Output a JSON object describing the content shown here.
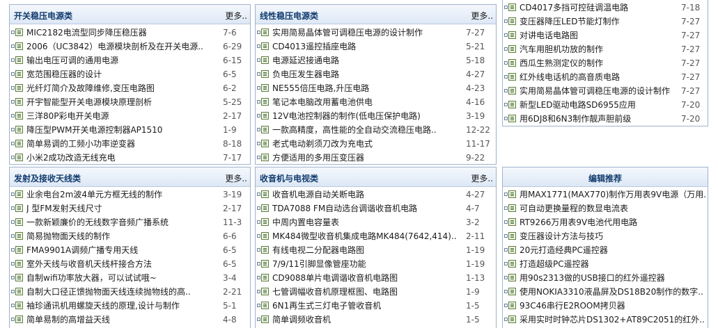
{
  "p1": {
    "title": "开关稳压电源类",
    "more": "更多..",
    "items": [
      {
        "t": "MIC2182电流型同步降压稳压器",
        "d": "7-6"
      },
      {
        "t": "2006（UC3842）电源模块剖析及在开关电源..",
        "d": "6-29"
      },
      {
        "t": "输出电压可调的通用电源",
        "d": "6-15"
      },
      {
        "t": "宽范围稳压器的设计",
        "d": "6-5"
      },
      {
        "t": "光纤灯简介及故障维修,变压电路图",
        "d": "6-2"
      },
      {
        "t": "开宇智能型开关电源模块原理剖析",
        "d": "5-25"
      },
      {
        "t": "三洋80P彩电开关电源",
        "d": "2-17"
      },
      {
        "t": "降压型PWM开关电源控制器AP1510",
        "d": "1-9"
      },
      {
        "t": "简单易调的工频小功率逆变器",
        "d": "8-18"
      },
      {
        "t": "小米2成功改造无线充电",
        "d": "7-17"
      }
    ]
  },
  "p2": {
    "title": "线性稳压电源类",
    "more": "更多..",
    "items": [
      {
        "t": "实用简易晶体管可调稳压电源的设计制作",
        "d": "7-27"
      },
      {
        "t": "CD4013遥控插座电路",
        "d": "5-21"
      },
      {
        "t": "电源延迟接通电路",
        "d": "5-18"
      },
      {
        "t": "负电压发生器电路",
        "d": "4-27"
      },
      {
        "t": "NE555倍压电路,升压电路",
        "d": "4-23"
      },
      {
        "t": "笔记本电脑改用蓄电池供电",
        "d": "4-16"
      },
      {
        "t": "12V电池控制器的制作(低电压保护电路)",
        "d": "3-19"
      },
      {
        "t": "一款高精度，高性能的全自动交流稳压电路..",
        "d": "12-22"
      },
      {
        "t": "老式电动剃须刀改为充电式",
        "d": "11-17"
      },
      {
        "t": "方便适用的多用压变压器",
        "d": "9-22"
      }
    ]
  },
  "p3": {
    "items": [
      {
        "t": "CD4017多挡可控硅调温电路",
        "d": "7-18"
      },
      {
        "t": "变压器降压LED节能灯制作",
        "d": "7-27"
      },
      {
        "t": "对讲电话电路图",
        "d": "7-27"
      },
      {
        "t": "汽车用胆机功放的制作",
        "d": "7-27"
      },
      {
        "t": "西瓜生熟测定仪的制作",
        "d": "7-27"
      },
      {
        "t": "红外线电话机的高音质电路",
        "d": "7-27"
      },
      {
        "t": "实用简易晶体管可调稳压电源的设计制作",
        "d": "7-27"
      },
      {
        "t": "新型LED驱动电路SD6955应用",
        "d": "7-20"
      },
      {
        "t": "用6DJ8和6N3制作靓声胆前级",
        "d": "7-20"
      }
    ]
  },
  "p4": {
    "title": "发射及接收天线类",
    "more": "更多..",
    "items": [
      {
        "t": "业余电台2m波4单元方框无线的制作",
        "d": "3-19"
      },
      {
        "t": "J 型FM发射天线尺寸",
        "d": "2-17"
      },
      {
        "t": "一款新颖廉价的无线数字音频广播系统",
        "d": "11-3"
      },
      {
        "t": "简易抛物面天线的制作",
        "d": "6-6"
      },
      {
        "t": "FMA9901A调频广播专用天线",
        "d": "6-5"
      },
      {
        "t": "室外天线与收音机天线杆接合方法",
        "d": "6-5"
      },
      {
        "t": "自制wifi功率放大器，可以试试哦~",
        "d": "3-4"
      },
      {
        "t": "自制大口径正馈抛物面天线连续抛物线的高..",
        "d": "2-21"
      },
      {
        "t": "袖珍通讯机用螺旋天线的原理,设计与制作",
        "d": "5-1"
      },
      {
        "t": "简单易制的高增益天线",
        "d": "4-8"
      }
    ]
  },
  "p5": {
    "title": "收音机与电视类",
    "more": "更多..",
    "items": [
      {
        "t": "收音机电源自动关断电路",
        "d": "4-27"
      },
      {
        "t": "TDA7088 FM自动选台调谐收音机电路",
        "d": "4-7"
      },
      {
        "t": "中周内置电容量表",
        "d": "3-2"
      },
      {
        "t": "MK484微型收音机集成电路MK484(7642,414)..",
        "d": "2-11"
      },
      {
        "t": "有线电视二分配器电路图",
        "d": "1-19"
      },
      {
        "t": "7/9/11引脚显像管座功能",
        "d": "1-19"
      },
      {
        "t": "CD9088单片电调谐收音机电路图",
        "d": "1-13"
      },
      {
        "t": "七管调幅收音机原理框图、电路图",
        "d": "1-9"
      },
      {
        "t": "6N1再生式三灯电子管收音机",
        "d": "1-5"
      },
      {
        "t": "简单调频收音机",
        "d": "1-5"
      }
    ]
  },
  "p6": {
    "title": "编辑推荐",
    "items": [
      {
        "t": "用MAX1771(MAX770)制作万用表9V电源（万用.."
      },
      {
        "t": "可自动更换量程的数显电流表"
      },
      {
        "t": "RT9266万用表9V电池代用电路"
      },
      {
        "t": "变压器设计方法与技巧"
      },
      {
        "t": "20元打造经典PC遥控器"
      },
      {
        "t": "打造超级PC遥控器"
      },
      {
        "t": "用90s2313做的USB接口的红外遥控器"
      },
      {
        "t": "使用NOKIA3310液晶屏及DS18B20制作的数字.."
      },
      {
        "t": "93C46串行E2ROOM拷贝器"
      },
      {
        "t": "采用实时时钟芯片DS1302+AT89C2051的红外.."
      }
    ]
  }
}
